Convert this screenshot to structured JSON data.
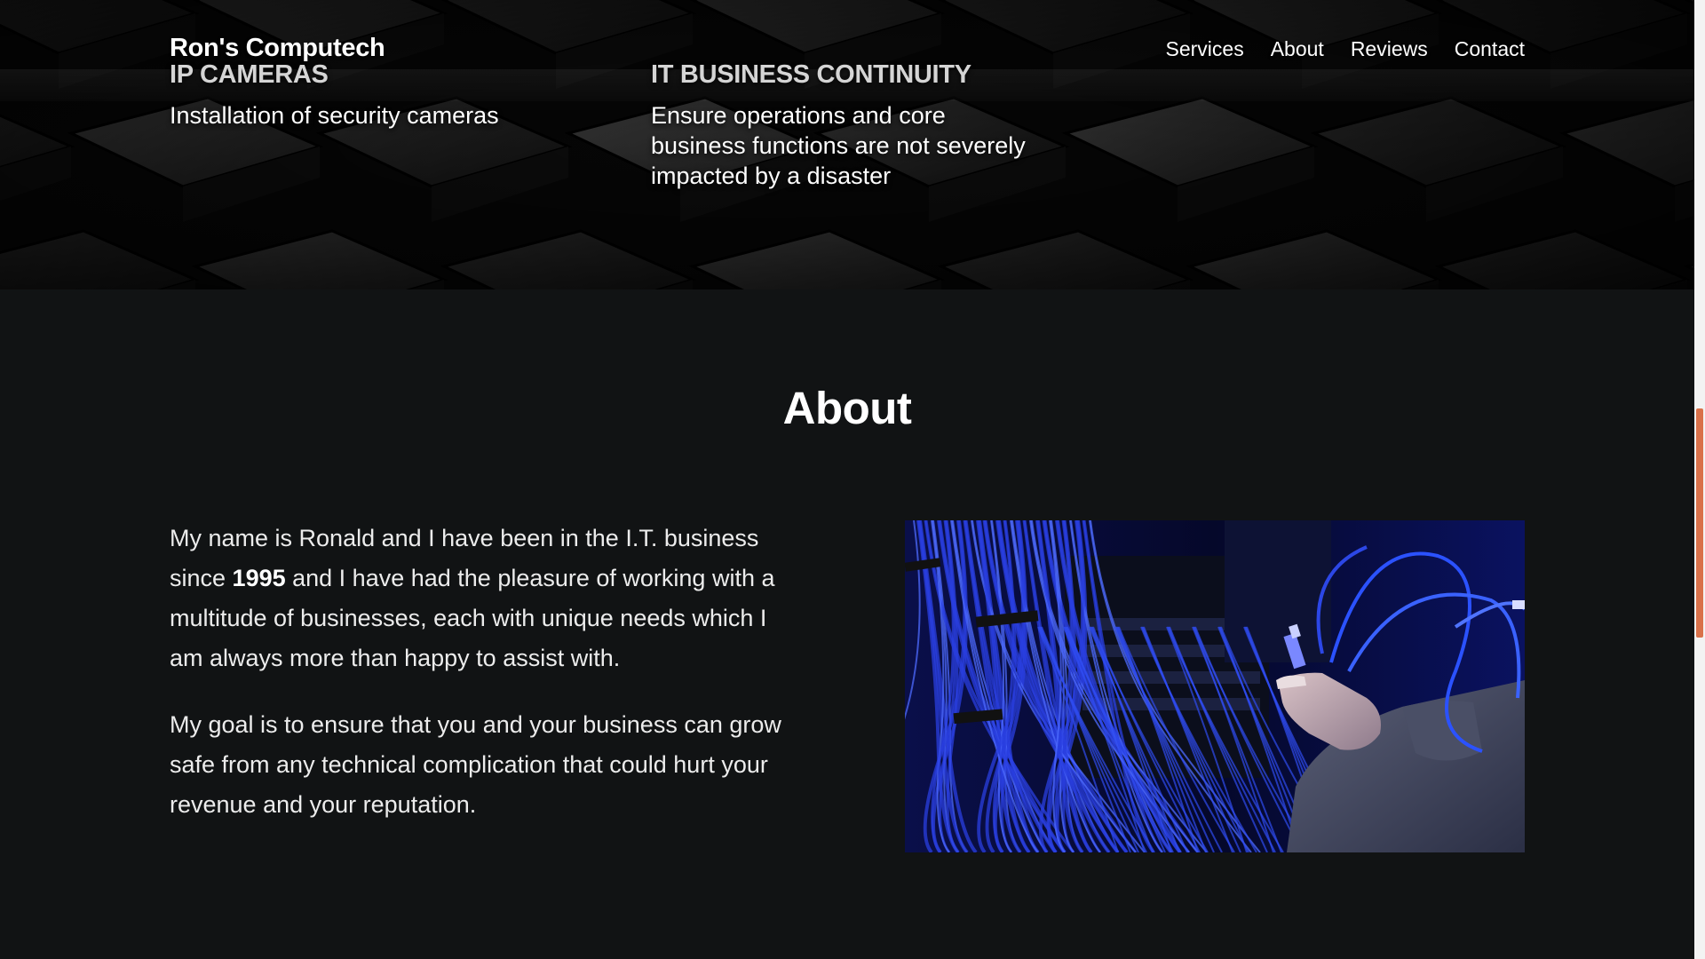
{
  "brand": "Ron's Computech",
  "nav": {
    "services": "Services",
    "about": "About",
    "reviews": "Reviews",
    "contact": "Contact"
  },
  "services": [
    {
      "title": "IP CAMERAS",
      "description": "Installation of security cameras"
    },
    {
      "title": "IT BUSINESS CONTINUITY",
      "description": "Ensure operations and core business functions are not severely impacted by a disaster"
    }
  ],
  "about": {
    "title": "About",
    "paragraph1_before": "My name is Ronald and I have been in the I.T. business since ",
    "paragraph1_year": "1995",
    "paragraph1_after": " and I have had the pleasure of working with a multitude of businesses, each with unique needs which I am always more than happy to assist with.",
    "paragraph2": "My goal is to ensure that you and your business can grow safe from any technical complication that could hurt your revenue and your reputation."
  },
  "colors": {
    "page_background": "#111314",
    "text": "#ffffff",
    "scroll_thumb": "#d9714a",
    "cable_blue": "#2a3fe0"
  },
  "scroll_position": 0.43
}
